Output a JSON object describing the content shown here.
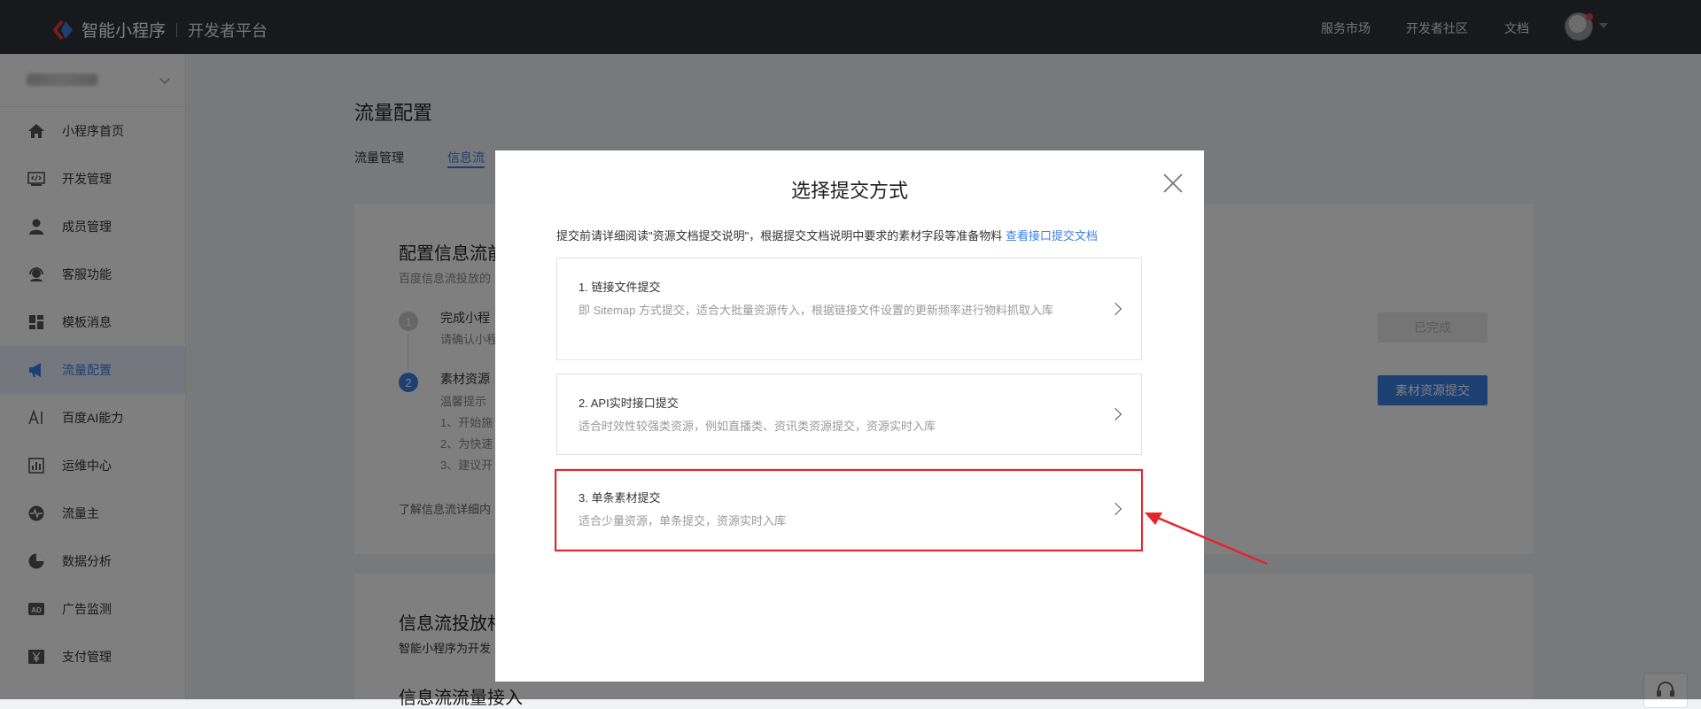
{
  "header": {
    "brand": "智能小程序",
    "subtitle": "开发者平台",
    "nav": [
      "服务市场",
      "开发者社区",
      "文档"
    ]
  },
  "sidebar": {
    "items": [
      {
        "label": "小程序首页",
        "icon": "home-icon"
      },
      {
        "label": "开发管理",
        "icon": "code-icon"
      },
      {
        "label": "成员管理",
        "icon": "user-icon"
      },
      {
        "label": "客服功能",
        "icon": "headset-icon"
      },
      {
        "label": "模板消息",
        "icon": "template-icon"
      },
      {
        "label": "流量配置",
        "icon": "megaphone-icon",
        "active": true
      },
      {
        "label": "百度AI能力",
        "icon": "ai-icon"
      },
      {
        "label": "运维中心",
        "icon": "chart-bar-icon"
      },
      {
        "label": "流量主",
        "icon": "pulse-icon"
      },
      {
        "label": "数据分析",
        "icon": "pie-chart-icon"
      },
      {
        "label": "广告监测",
        "icon": "ad-icon"
      },
      {
        "label": "支付管理",
        "icon": "yen-icon"
      }
    ]
  },
  "main": {
    "title": "流量配置",
    "tabs": [
      "流量管理",
      "信息流"
    ],
    "active_tab": "信息流",
    "card1": {
      "title": "配置信息流前",
      "desc": "百度信息流投放的",
      "step1_title": "完成小程",
      "step1_sub": "请确认小程",
      "step1_button": "已完成",
      "step2_title": "素材资源",
      "step2_lines": [
        "温馨提示",
        "1、开始施",
        "2、为快速",
        "3、建议开"
      ],
      "step2_button": "素材资源提交",
      "footer": "了解信息流详细内"
    },
    "card2": {
      "title": "信息流投放相",
      "desc": "智能小程序为开发",
      "sub": "信息流流量接入"
    }
  },
  "modal": {
    "title": "选择提交方式",
    "tip": "提交前请详细阅读\"资源文档提交说明\"，根据提交文档说明中要求的素材字段等准备物料 ",
    "tip_link": "查看接口提交文档",
    "options": [
      {
        "title": "1. 链接文件提交",
        "desc": "即 Sitemap 方式提交，适合大批量资源传入，根据链接文件设置的更新频率进行物料抓取入库"
      },
      {
        "title": "2. API实时接口提交",
        "desc": "适合时效性较强类资源，例如直播类、资讯类资源提交，资源实时入库"
      },
      {
        "title": "3. 单条素材提交",
        "desc": "适合少量资源，单条提交，资源实时入库"
      }
    ]
  },
  "colors": {
    "accent": "#3b80e6",
    "header_bg": "#303238",
    "highlight": "#e8232a"
  }
}
